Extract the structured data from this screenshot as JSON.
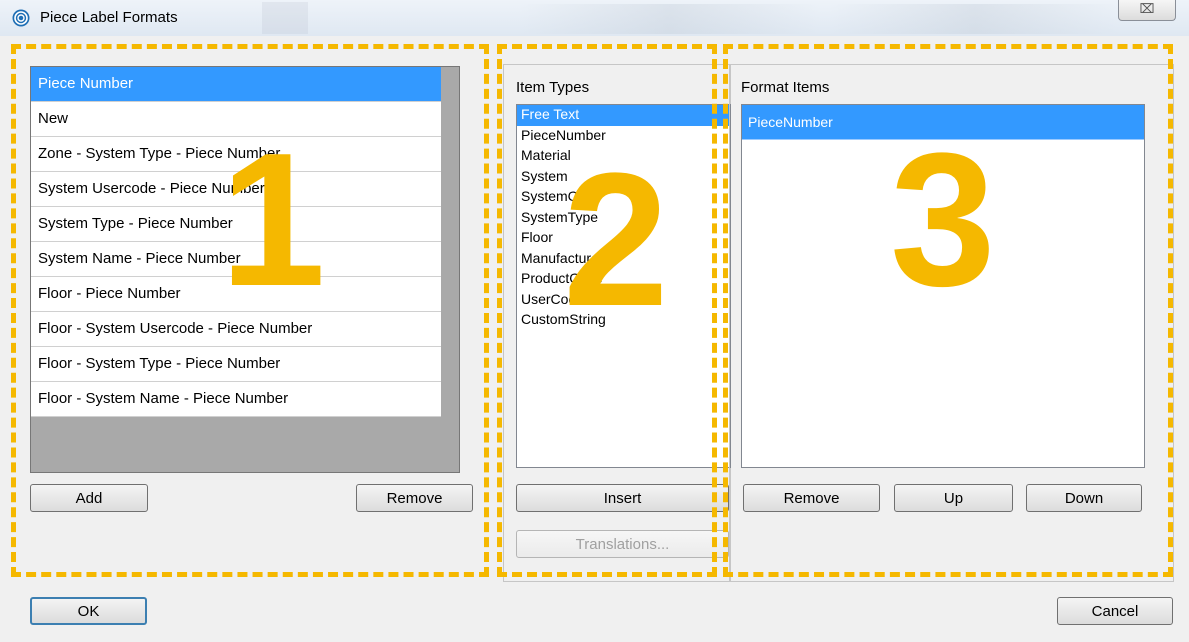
{
  "window": {
    "title": "Piece Label Formats",
    "close_label": "⌧"
  },
  "piece_labels": {
    "items": [
      "Piece Number",
      "New",
      "Zone - System Type -  Piece Number",
      "System Usercode - Piece Number",
      "System Type - Piece Number",
      "System Name - Piece Number",
      "Floor - Piece Number",
      "Floor - System Usercode - Piece Number",
      "Floor - System Type - Piece Number",
      "Floor - System Name - Piece Number"
    ],
    "add_label": "Add",
    "remove_label": "Remove"
  },
  "item_types": {
    "heading": "Item Types",
    "items": [
      "Free Text",
      "PieceNumber",
      "Material",
      "System",
      "SystemCode",
      "SystemType",
      "Floor",
      "Manufacturer",
      "ProductCode",
      "UserCode",
      "CustomString"
    ],
    "insert_label": "Insert",
    "translations_label": "Translations..."
  },
  "format_items": {
    "heading": "Format Items",
    "items": [
      "PieceNumber"
    ],
    "remove_label": "Remove",
    "up_label": "Up",
    "down_label": "Down"
  },
  "footer": {
    "ok_label": "OK",
    "cancel_label": "Cancel"
  },
  "annotations": {
    "one": "1",
    "two": "2",
    "three": "3",
    "color": "#f5b800"
  }
}
